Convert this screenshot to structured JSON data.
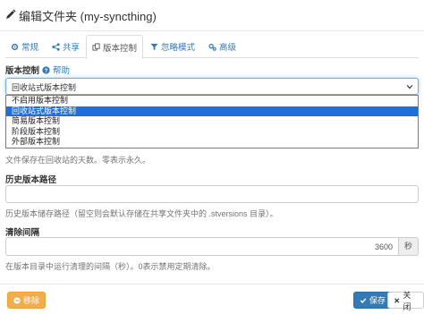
{
  "header": {
    "title": "编辑文件夹 (my-syncthing)",
    "icon": "pencil-icon"
  },
  "tabs": [
    {
      "label": "常规",
      "icon": "gear-icon"
    },
    {
      "label": "共享",
      "icon": "share-icon"
    },
    {
      "label": "版本控制",
      "icon": "copy-icon"
    },
    {
      "label": "忽略模式",
      "icon": "filter-icon"
    },
    {
      "label": "高级",
      "icon": "gears-icon"
    }
  ],
  "versioning": {
    "label": "版本控制",
    "help": "帮助",
    "selected": "回收站式版本控制",
    "options": [
      "不启用版本控制",
      "回收站式版本控制",
      "简易版本控制",
      "阶段版本控制",
      "外部版本控制"
    ],
    "cleanout_help": "文件保存在回收站的天数。零表示永久。"
  },
  "path": {
    "label": "历史版本路径",
    "value": "",
    "help": "历史版本储存路径（留空则会默认存储在共享文件夹中的 .stversions 目录）。"
  },
  "cleanup": {
    "label": "清除间隔",
    "value": "3600",
    "unit": "秒",
    "help": "在版本目录中运行清理的间隔（秒）。0表示禁用定期清除。"
  },
  "footer": {
    "remove": "移除",
    "save": "保存",
    "close": "关闭"
  },
  "colors": {
    "primary": "#337ab7",
    "warning": "#f0ad4e",
    "selection": "#1e6fd9"
  }
}
